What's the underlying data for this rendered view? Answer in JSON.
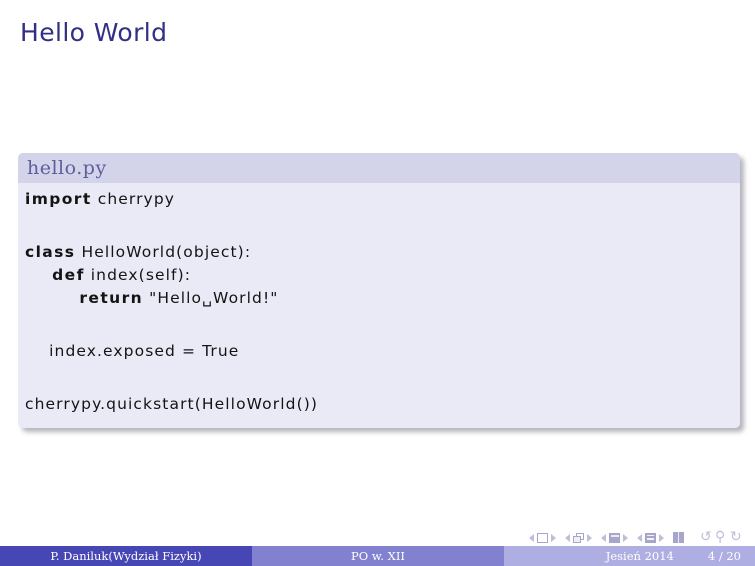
{
  "slide": {
    "frame_title": "Hello World",
    "title_color": "#332f84"
  },
  "code_block": {
    "title": "hello.py",
    "lines": [
      {
        "id": "line-1",
        "keyword": "import",
        "rest": " cherrypy"
      },
      {
        "id": "line-2",
        "keyword": "",
        "rest": ""
      },
      {
        "id": "line-3",
        "keyword": "class",
        "rest": " HelloWorld(object):"
      },
      {
        "id": "line-4",
        "keyword": "    def",
        "rest": " index(self):"
      },
      {
        "id": "line-5",
        "keyword": "        return",
        "rest": " \"Hello␣World!\""
      },
      {
        "id": "line-6",
        "keyword": "",
        "rest": ""
      },
      {
        "id": "line-7",
        "keyword": "",
        "rest": "    index.exposed = True"
      },
      {
        "id": "line-8",
        "keyword": "",
        "rest": ""
      },
      {
        "id": "line-9",
        "keyword": "",
        "rest": "cherrypy.quickstart(HelloWorld())"
      }
    ],
    "header_bg": "#d3d3ea",
    "body_bg": "#eaeaf6",
    "header_fg": "#5e5e9e"
  },
  "navigation": {
    "slide_icon": "slide-navigation-icon",
    "frame_icon": "frame-navigation-icon",
    "subsection_icon": "subsection-navigation-icon",
    "section_icon": "section-navigation-icon",
    "doc_icon": "document-navigation-icon",
    "back_icon": "go-back-icon",
    "search_icon": "search-icon",
    "forward_icon": "go-forward-icon",
    "back_glyph": "↺",
    "search_glyph": "⚲",
    "forward_glyph": "↻"
  },
  "footer": {
    "author": "P. Daniluk(Wydział Fizyki)",
    "title": "PO w. XII",
    "date": "Jesień 2014",
    "page": "4 / 20",
    "author_bg": "#4646b4",
    "title_bg": "#8181cf",
    "meta_bg": "#aeaee2"
  }
}
